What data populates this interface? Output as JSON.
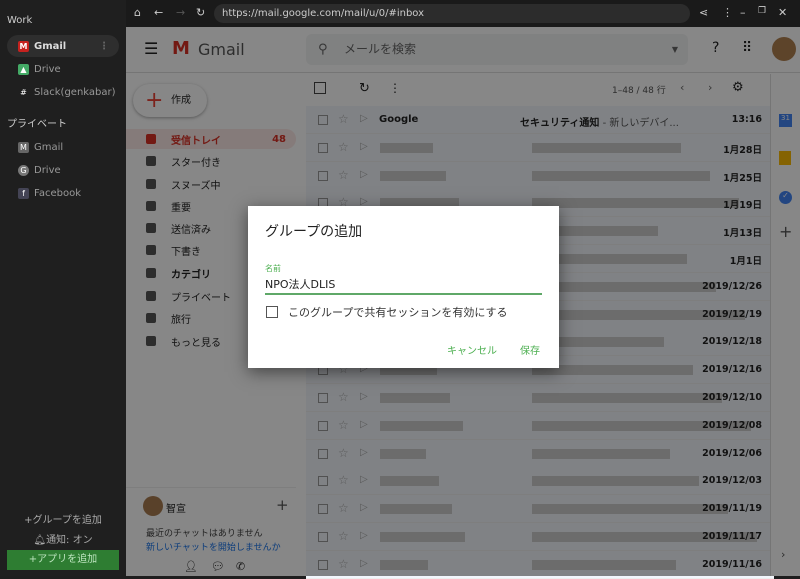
{
  "sidebar": {
    "work_label": "Work",
    "work_items": [
      {
        "label": "Gmail",
        "icon": "gmail-icon"
      },
      {
        "label": "Drive",
        "icon": "drive-icon"
      },
      {
        "label": "Slack(genkabar)",
        "icon": "slack-icon"
      }
    ],
    "private_label": "プライベート",
    "private_items": [
      {
        "label": "Gmail",
        "icon": "gmail-icon"
      },
      {
        "label": "Drive",
        "icon": "google-icon"
      },
      {
        "label": "Facebook",
        "icon": "facebook-icon"
      }
    ],
    "add_group": "+グループを追加",
    "notify": "通知: オン",
    "add_app": "+アプリを追加",
    "add_app_color": "#2e7d32"
  },
  "browser": {
    "url": "https://mail.google.com/mail/u/0/#inbox"
  },
  "gmail": {
    "logo": "Gmail",
    "search_placeholder": "メールを検索",
    "compose": "作成",
    "nav": [
      {
        "label": "受信トレイ",
        "count": "48"
      },
      {
        "label": "スター付き"
      },
      {
        "label": "スヌーズ中"
      },
      {
        "label": "重要"
      },
      {
        "label": "送信済み"
      },
      {
        "label": "下書き"
      },
      {
        "label": "カテゴリ"
      },
      {
        "label": "プライベート"
      },
      {
        "label": "旅行"
      },
      {
        "label": "もっと見る"
      }
    ],
    "pager": "1–48 / 48 行",
    "first": {
      "sender": "Google",
      "subject": "セキュリティ通知",
      "snippet": " - 新しいデバイ..."
    },
    "dates": [
      "13:16",
      "1月28日",
      "1月25日",
      "1月19日",
      "1月13日",
      "1月1日",
      "2019/12/26",
      "2019/12/19",
      "2019/12/18",
      "2019/12/16",
      "2019/12/10",
      "2019/12/08",
      "2019/12/06",
      "2019/12/03",
      "2019/11/19",
      "2019/11/17",
      "2019/11/16"
    ],
    "chat": {
      "user": "智宣",
      "empty": "最近のチャットはありません",
      "start": "新しいチャットを開始しませんか"
    }
  },
  "dialog": {
    "title": "グループの追加",
    "name_label": "名前",
    "name_value": "NPO法人DLIS",
    "checkbox_label": "このグループで共有セッションを有効にする",
    "cancel": "キャンセル",
    "save": "保存"
  }
}
